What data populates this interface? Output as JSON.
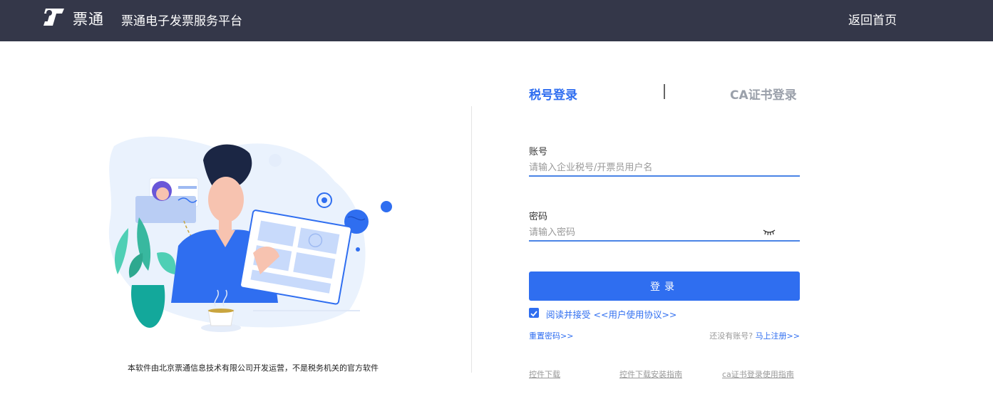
{
  "header": {
    "brand": "票通",
    "platform_title": "票通电子发票服务平台",
    "home_link": "返回首页"
  },
  "footer_note": "本软件由北京票通信息技术有限公司开发运营，不是税务机关的官方软件",
  "tabs": {
    "tax_login": "税号登录",
    "ca_login": "CA证书登录"
  },
  "form": {
    "account_label": "账号",
    "account_placeholder": "请输入企业税号/开票员用户名",
    "password_label": "密码",
    "password_placeholder": "请输入密码",
    "login_button": "登录",
    "agree_prefix": "阅读并接受",
    "agreement_link": "<<用户使用协议>>",
    "agree_checked": true,
    "reset_password": "重置密码>>",
    "no_account": "还没有账号?",
    "register_now": "马上注册>>"
  },
  "bottom_links": {
    "plugin_download": "控件下载",
    "plugin_install_guide": "控件下载安装指南",
    "ca_login_guide": "ca证书登录使用指南"
  },
  "colors": {
    "header_bg": "#343749",
    "primary": "#2f6ef0",
    "tab_inactive": "#9aa0aa"
  }
}
